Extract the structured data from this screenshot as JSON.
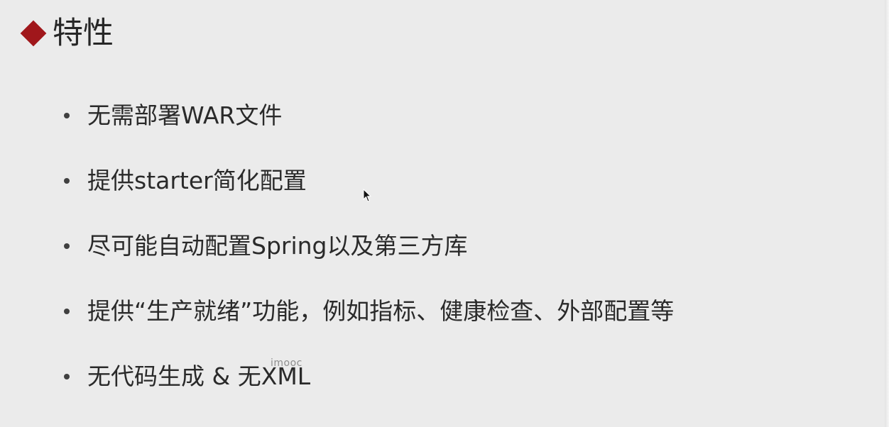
{
  "slide": {
    "title": "特性",
    "bullets": [
      "无需部署WAR文件",
      "提供starter简化配置",
      "尽可能自动配置Spring以及第三方库",
      "提供“生产就绪”功能，例如指标、健康检查、外部配置等",
      "无代码生成 & 无XML"
    ],
    "watermark": "imooc"
  },
  "colors": {
    "background": "#ebebeb",
    "title_marker": "#a0171b",
    "text": "#262626"
  },
  "icons": {
    "title_marker": "diamond-icon",
    "cursor": "mouse-pointer-icon"
  }
}
